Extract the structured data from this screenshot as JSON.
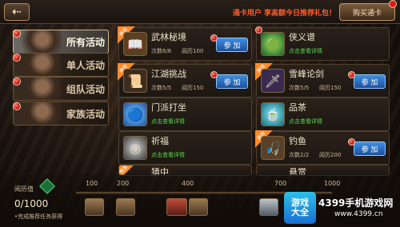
{
  "header": {
    "back_icon": "back-arrow-icon",
    "back_glyph": "⇠",
    "vip_text": "通卡用户 享高额今日推荐礼包！",
    "buy_label": "购买通卡"
  },
  "tabs": [
    {
      "label": "所有活动",
      "active": true
    },
    {
      "label": "单人活动",
      "active": false
    },
    {
      "label": "组队活动",
      "active": false
    },
    {
      "label": "家族活动",
      "active": false
    }
  ],
  "cards": [
    {
      "name": "武林秘境",
      "count": "次数6/6",
      "activity": "阅历100",
      "join": "参 加",
      "ribbon": "推荐",
      "icon": "book-icon",
      "glyph": "📖",
      "detail": ""
    },
    {
      "name": "侠义谱",
      "count": "",
      "activity": "",
      "join": "",
      "ribbon": "",
      "icon": "green-orb-icon",
      "glyph": "🟢",
      "detail": "点击查看详情"
    },
    {
      "name": "江湖挑战",
      "count": "次数5/5",
      "activity": "阅历150",
      "join": "参 加",
      "ribbon": "推荐",
      "icon": "scroll-icon",
      "glyph": "📜",
      "detail": ""
    },
    {
      "name": "雪峰论剑",
      "count": "次数5/5",
      "activity": "阅历150",
      "join": "参 加",
      "ribbon": "推荐",
      "icon": "sword-icon",
      "glyph": "🗡",
      "detail": ""
    },
    {
      "name": "门派打坐",
      "count": "",
      "activity": "",
      "join": "",
      "ribbon": "",
      "icon": "blue-orb-icon",
      "glyph": "🔵",
      "detail": "点击查看详情"
    },
    {
      "name": "品茶",
      "count": "",
      "activity": "",
      "join": "",
      "ribbon": "",
      "icon": "tea-icon",
      "glyph": "🍵",
      "detail": "点击查看详情"
    },
    {
      "name": "祈福",
      "count": "",
      "activity": "",
      "join": "",
      "ribbon": "",
      "icon": "prayer-icon",
      "glyph": "◎",
      "detail": "点击查看详情"
    },
    {
      "name": "钓鱼",
      "count": "次数2/2",
      "activity": "阅历200",
      "join": "参 加",
      "ribbon": "推荐",
      "icon": "fishing-icon",
      "glyph": "🎣",
      "detail": ""
    },
    {
      "name": "猜中",
      "count": "",
      "activity": "",
      "join": "",
      "ribbon": "推荐",
      "icon": "misc-icon",
      "glyph": "✦",
      "detail": ""
    },
    {
      "name": "悬赏",
      "count": "",
      "activity": "",
      "join": "",
      "ribbon": "",
      "icon": "misc-icon",
      "glyph": "✦",
      "detail": ""
    }
  ],
  "bottom": {
    "yueli_label": "阅历值",
    "score": "0/1000",
    "hint": "•完成推荐任务获得",
    "milestones": [
      "100",
      "200",
      "400",
      "700",
      "1000"
    ]
  },
  "watermark": {
    "logo_top": "游戏",
    "logo_bottom": "大全",
    "title": "4399手机游戏网",
    "url": "www.4399.cn"
  }
}
